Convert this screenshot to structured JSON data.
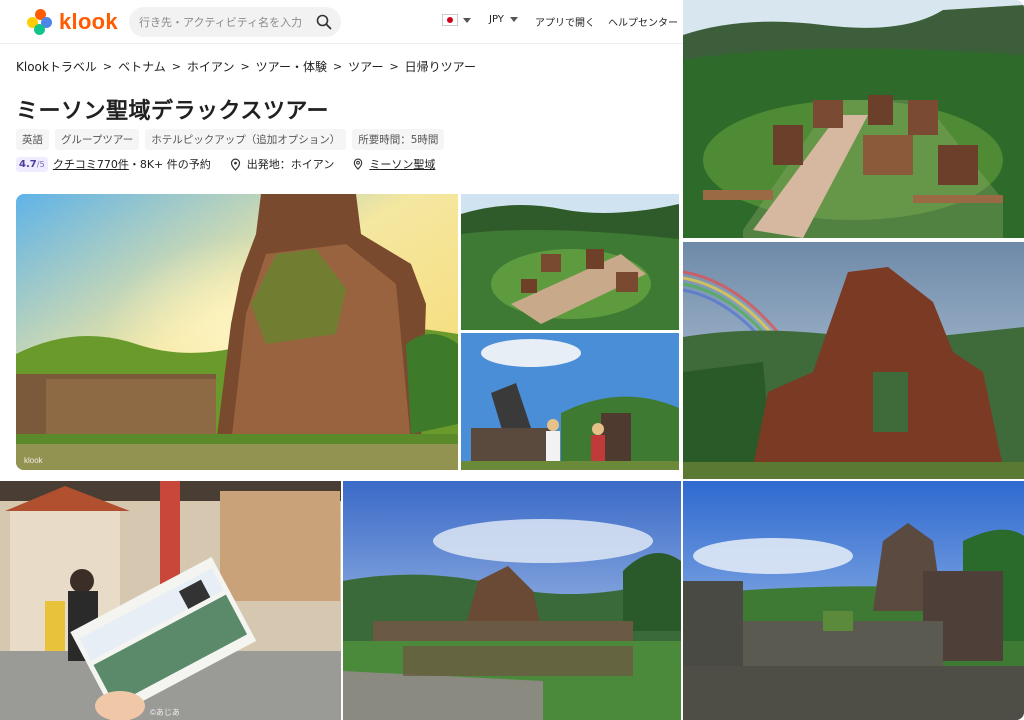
{
  "header": {
    "logo_text": "klook",
    "search_placeholder": "行き先・アクティビティ名を入力",
    "currency": "JPY",
    "app_link": "アプリで開く",
    "help_link": "ヘルプセンター"
  },
  "breadcrumb": [
    "Klookトラベル",
    "ベトナム",
    "ホイアン",
    "ツアー・体験",
    "ツアー",
    "日帰りツアー"
  ],
  "title": "ミーソン聖域デラックスツアー",
  "tags": [
    "英語",
    "グループツアー",
    "ホテルピックアップ（追加オプション）",
    "所要時間：5時間"
  ],
  "rating": {
    "score": "4.7",
    "max": "/5"
  },
  "reviews": "クチコミ770件",
  "bookings": "・8K+ 件の予約",
  "departure": "出発地：ホイアン",
  "location": "ミーソン聖域",
  "photos": {
    "hero_watermark": "klook",
    "ticket_watermark": "©あじあ"
  },
  "colors": {
    "brand": "#ff5b00",
    "rating_bg": "#f0ecff"
  }
}
